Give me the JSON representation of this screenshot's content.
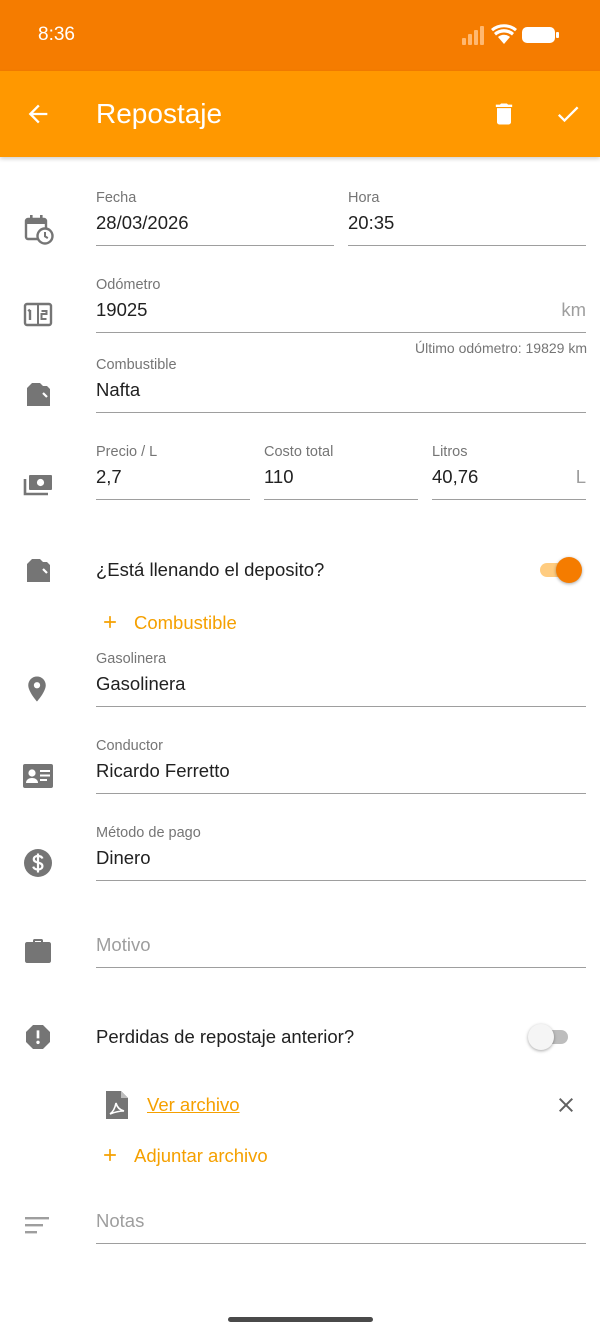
{
  "status_bar": {
    "time": "8:36"
  },
  "app_bar": {
    "title": "Repostaje"
  },
  "fecha": {
    "label": "Fecha",
    "value": "28/03/2026"
  },
  "hora": {
    "label": "Hora",
    "value": "20:35"
  },
  "odometro": {
    "label": "Odómetro",
    "value": "19025",
    "suffix": "km",
    "helper": "Último odómetro: 19829 km"
  },
  "combustible": {
    "label": "Combustible",
    "value": "Nafta"
  },
  "precio": {
    "label": "Precio / L",
    "value": "2,7"
  },
  "costo_total": {
    "label": "Costo total",
    "value": "110"
  },
  "litros": {
    "label": "Litros",
    "value": "40,76",
    "suffix": "L"
  },
  "lleno": {
    "label": "¿Está llenando el deposito?",
    "checked": true
  },
  "add_combustible": {
    "label": "Combustible"
  },
  "gasolinera": {
    "label": "Gasolinera",
    "value": "Gasolinera"
  },
  "conductor": {
    "label": "Conductor",
    "value": "Ricardo Ferretto"
  },
  "metodo_pago": {
    "label": "Método de pago",
    "value": "Dinero"
  },
  "motivo": {
    "placeholder": "Motivo"
  },
  "perdidas": {
    "label": "Perdidas de repostaje anterior?",
    "checked": false
  },
  "archivo": {
    "link": "Ver archivo"
  },
  "adjuntar": {
    "label": "Adjuntar archivo"
  },
  "notas": {
    "placeholder": "Notas"
  },
  "colors": {
    "primary": "#ff9800",
    "primary_dark": "#f57c00",
    "accent_text": "#f5a000",
    "icon_gray": "#757575"
  },
  "icons": [
    "back-arrow-icon",
    "trash-icon",
    "check-icon",
    "calendar-clock-icon",
    "odometer-icon",
    "fuel-can-icon",
    "cash-icon",
    "location-pin-icon",
    "id-card-icon",
    "dollar-circle-icon",
    "briefcase-icon",
    "alert-octagon-icon",
    "pdf-file-icon",
    "close-icon",
    "plus-icon",
    "notes-icon"
  ]
}
